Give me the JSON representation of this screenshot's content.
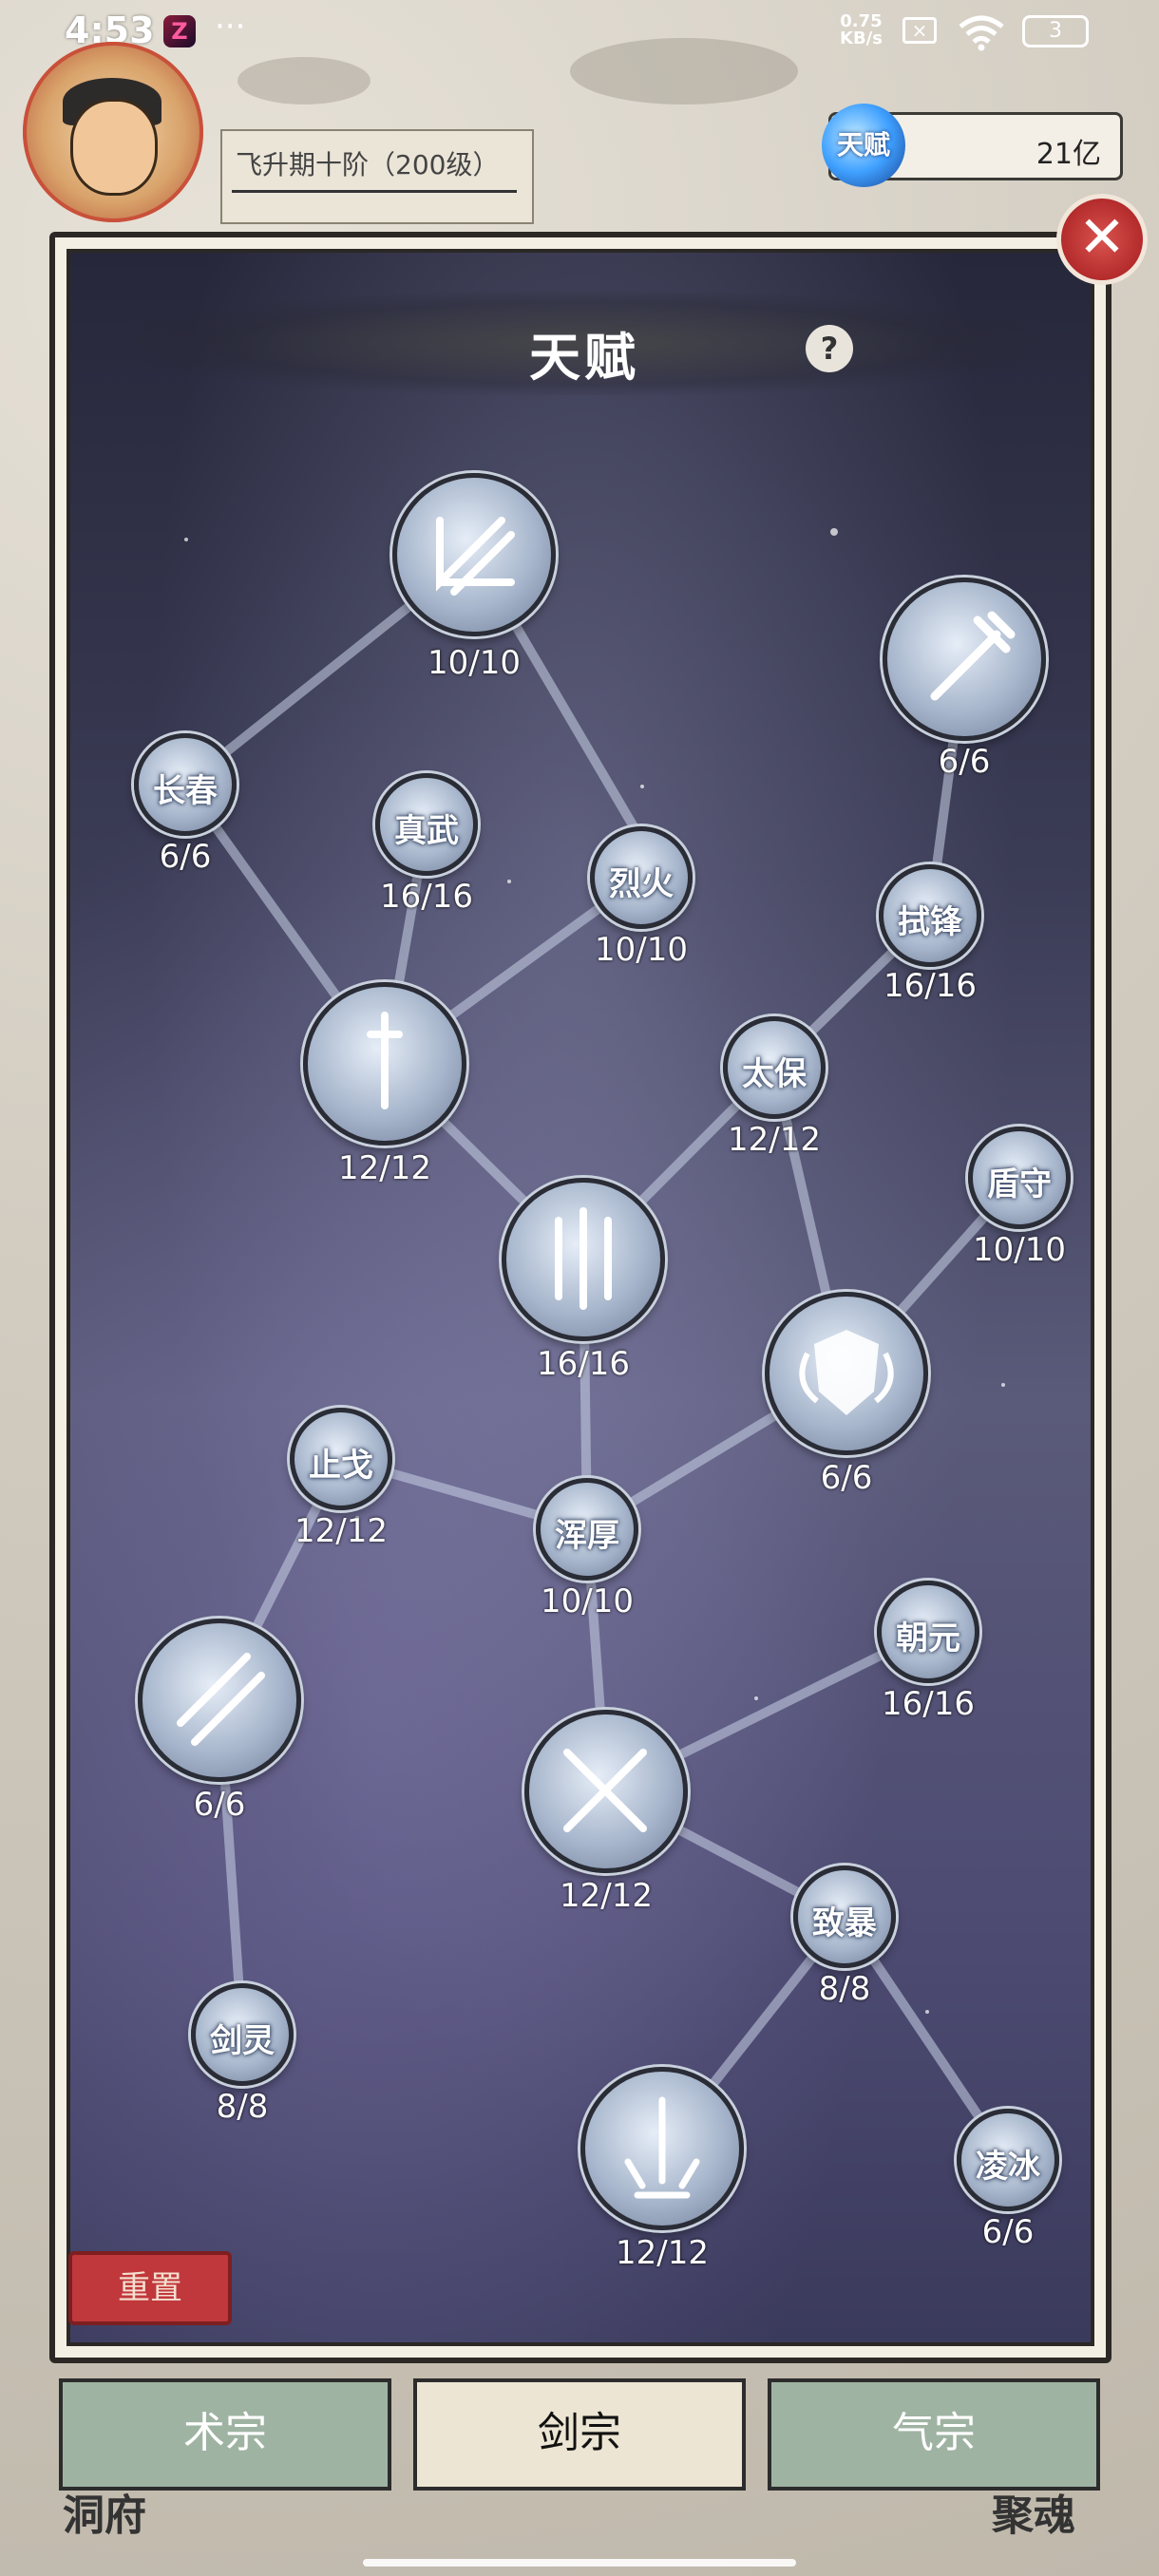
{
  "status_bar": {
    "time": "4:53",
    "net_speed_value": "0.75",
    "net_speed_unit": "KB/s",
    "battery": "3"
  },
  "hud": {
    "rank_text": "飞升期十阶（200级）",
    "talent_gem_label": "天赋",
    "talent_value": "21亿"
  },
  "panel": {
    "title": "天赋",
    "help_label": "?",
    "close_label": "✕",
    "reset_label": "重置"
  },
  "nodes": {
    "n_top": {
      "label": "",
      "count": "10/10",
      "icon": "slash-swords-icon"
    },
    "n_weapon": {
      "label": "",
      "count": "6/6",
      "icon": "spear-icon"
    },
    "n_changchun": {
      "label": "长春",
      "count": "6/6"
    },
    "n_zhenwu": {
      "label": "真武",
      "count": "16/16"
    },
    "n_liehuo": {
      "label": "烈火",
      "count": "10/10"
    },
    "n_shifeng": {
      "label": "拭锋",
      "count": "16/16"
    },
    "n_sword1": {
      "label": "",
      "count": "12/12",
      "icon": "single-sword-icon"
    },
    "n_taibao": {
      "label": "太保",
      "count": "12/12"
    },
    "n_dunshou": {
      "label": "盾守",
      "count": "10/10"
    },
    "n_triple": {
      "label": "",
      "count": "16/16",
      "icon": "triple-swords-icon"
    },
    "n_shield": {
      "label": "",
      "count": "6/6",
      "icon": "winged-shield-icon"
    },
    "n_zhige": {
      "label": "止戈",
      "count": "12/12"
    },
    "n_hunhou": {
      "label": "浑厚",
      "count": "10/10"
    },
    "n_chaoyuan": {
      "label": "朝元",
      "count": "16/16"
    },
    "n_twin": {
      "label": "",
      "count": "6/6",
      "icon": "twin-swords-icon"
    },
    "n_crossed": {
      "label": "",
      "count": "12/12",
      "icon": "crossed-swords-icon"
    },
    "n_zhibao": {
      "label": "致暴",
      "count": "8/8"
    },
    "n_jianling": {
      "label": "剑灵",
      "count": "8/8"
    },
    "n_burst": {
      "label": "",
      "count": "12/12",
      "icon": "sword-burst-icon"
    },
    "n_lingbing": {
      "label": "凌冰",
      "count": "6/6"
    }
  },
  "tabs": [
    {
      "label": "术宗",
      "active": false
    },
    {
      "label": "剑宗",
      "active": true
    },
    {
      "label": "气宗",
      "active": false
    }
  ],
  "background_labels": {
    "left": "洞府",
    "right": "聚魂"
  }
}
